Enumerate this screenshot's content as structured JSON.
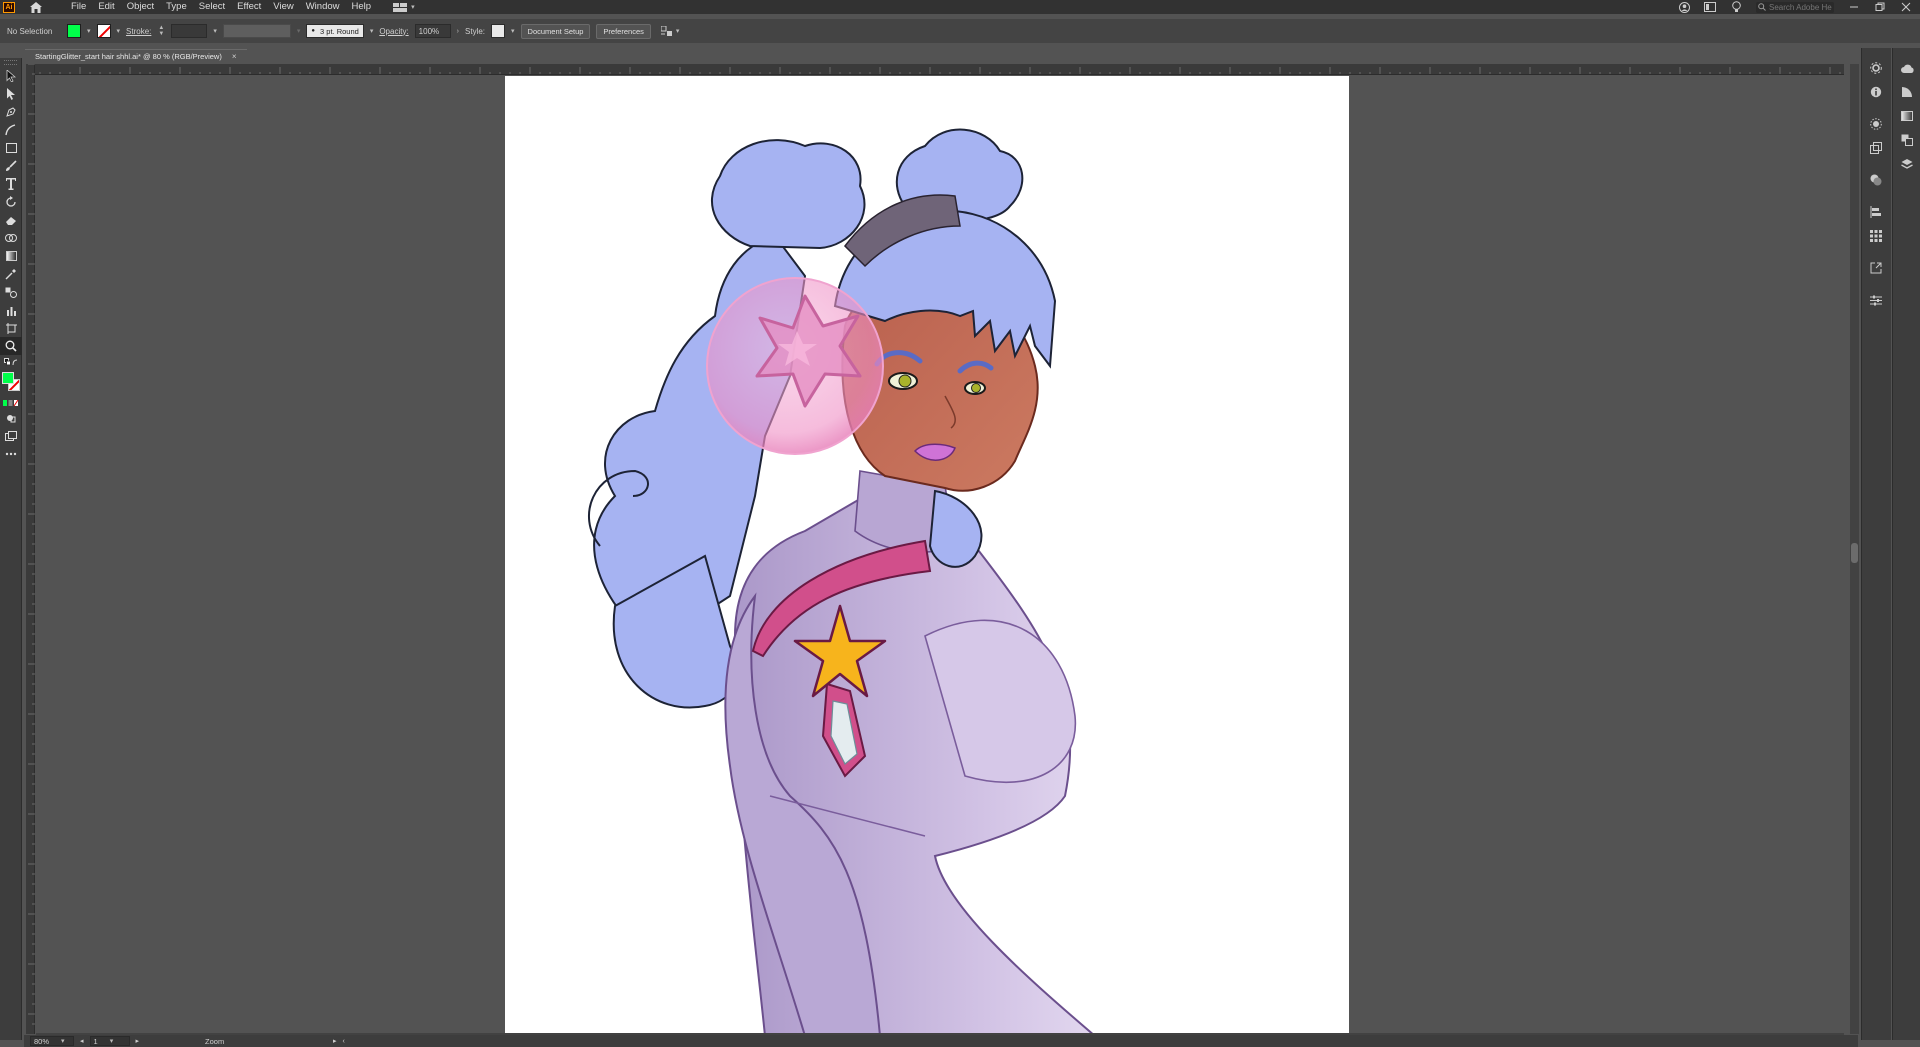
{
  "app": {
    "logo_text": "Ai",
    "menus": [
      "File",
      "Edit",
      "Object",
      "Type",
      "Select",
      "Effect",
      "View",
      "Window",
      "Help"
    ],
    "search_placeholder": "Search Adobe He"
  },
  "control_bar": {
    "selection_state": "No Selection",
    "fill_color": "#00ff4a",
    "stroke_label": "Stroke:",
    "brush_definition": "3 pt. Round",
    "opacity_label": "Opacity:",
    "opacity_value": "100%",
    "style_label": "Style:",
    "document_setup_label": "Document Setup",
    "preferences_label": "Preferences"
  },
  "document": {
    "tab_title": "StartingGlitter_start hair shhl.ai* @ 80 % (RGB/Preview)",
    "close_glyph": "×"
  },
  "status_bar": {
    "zoom_value": "80%",
    "artboard_number": "1",
    "current_tool": "Zoom"
  },
  "colors": {
    "fill": "#00ff4a",
    "hair": "#a7b4f3",
    "skin": "#c26f5a",
    "suit": "#c3b2dc",
    "sash": "#d14f8b",
    "star": "#f7b41c",
    "bubble": "#f4a9d2"
  }
}
